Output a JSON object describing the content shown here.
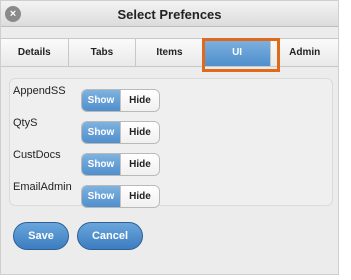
{
  "window": {
    "title": "Select Prefences"
  },
  "tabs": [
    {
      "label": "Details"
    },
    {
      "label": "Tabs"
    },
    {
      "label": "Items"
    },
    {
      "label": "UI",
      "active": true
    },
    {
      "label": "Admin"
    }
  ],
  "rows": [
    {
      "label": "AppendSS",
      "show_label": "Show",
      "hide_label": "Hide",
      "selected": "Show"
    },
    {
      "label": "QtyS",
      "show_label": "Show",
      "hide_label": "Hide",
      "selected": "Show"
    },
    {
      "label": "CustDocs",
      "show_label": "Show",
      "hide_label": "Hide",
      "selected": "Show"
    },
    {
      "label": "EmailAdmin",
      "show_label": "Show",
      "hide_label": "Hide",
      "selected": "Show"
    }
  ],
  "buttons": {
    "save": "Save",
    "cancel": "Cancel"
  },
  "colors": {
    "accent": "#4f8fcd",
    "highlight": "#e06a1c"
  }
}
